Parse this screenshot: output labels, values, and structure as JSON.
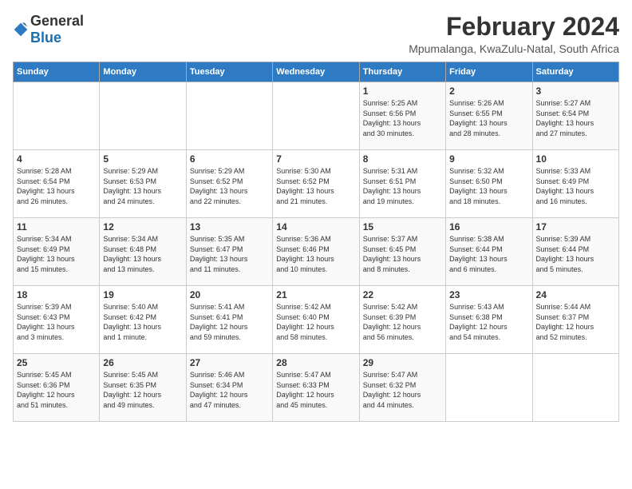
{
  "logo": {
    "general": "General",
    "blue": "Blue"
  },
  "title": "February 2024",
  "subtitle": "Mpumalanga, KwaZulu-Natal, South Africa",
  "weekdays": [
    "Sunday",
    "Monday",
    "Tuesday",
    "Wednesday",
    "Thursday",
    "Friday",
    "Saturday"
  ],
  "weeks": [
    [
      {
        "day": "",
        "info": ""
      },
      {
        "day": "",
        "info": ""
      },
      {
        "day": "",
        "info": ""
      },
      {
        "day": "",
        "info": ""
      },
      {
        "day": "1",
        "info": "Sunrise: 5:25 AM\nSunset: 6:56 PM\nDaylight: 13 hours\nand 30 minutes."
      },
      {
        "day": "2",
        "info": "Sunrise: 5:26 AM\nSunset: 6:55 PM\nDaylight: 13 hours\nand 28 minutes."
      },
      {
        "day": "3",
        "info": "Sunrise: 5:27 AM\nSunset: 6:54 PM\nDaylight: 13 hours\nand 27 minutes."
      }
    ],
    [
      {
        "day": "4",
        "info": "Sunrise: 5:28 AM\nSunset: 6:54 PM\nDaylight: 13 hours\nand 26 minutes."
      },
      {
        "day": "5",
        "info": "Sunrise: 5:29 AM\nSunset: 6:53 PM\nDaylight: 13 hours\nand 24 minutes."
      },
      {
        "day": "6",
        "info": "Sunrise: 5:29 AM\nSunset: 6:52 PM\nDaylight: 13 hours\nand 22 minutes."
      },
      {
        "day": "7",
        "info": "Sunrise: 5:30 AM\nSunset: 6:52 PM\nDaylight: 13 hours\nand 21 minutes."
      },
      {
        "day": "8",
        "info": "Sunrise: 5:31 AM\nSunset: 6:51 PM\nDaylight: 13 hours\nand 19 minutes."
      },
      {
        "day": "9",
        "info": "Sunrise: 5:32 AM\nSunset: 6:50 PM\nDaylight: 13 hours\nand 18 minutes."
      },
      {
        "day": "10",
        "info": "Sunrise: 5:33 AM\nSunset: 6:49 PM\nDaylight: 13 hours\nand 16 minutes."
      }
    ],
    [
      {
        "day": "11",
        "info": "Sunrise: 5:34 AM\nSunset: 6:49 PM\nDaylight: 13 hours\nand 15 minutes."
      },
      {
        "day": "12",
        "info": "Sunrise: 5:34 AM\nSunset: 6:48 PM\nDaylight: 13 hours\nand 13 minutes."
      },
      {
        "day": "13",
        "info": "Sunrise: 5:35 AM\nSunset: 6:47 PM\nDaylight: 13 hours\nand 11 minutes."
      },
      {
        "day": "14",
        "info": "Sunrise: 5:36 AM\nSunset: 6:46 PM\nDaylight: 13 hours\nand 10 minutes."
      },
      {
        "day": "15",
        "info": "Sunrise: 5:37 AM\nSunset: 6:45 PM\nDaylight: 13 hours\nand 8 minutes."
      },
      {
        "day": "16",
        "info": "Sunrise: 5:38 AM\nSunset: 6:44 PM\nDaylight: 13 hours\nand 6 minutes."
      },
      {
        "day": "17",
        "info": "Sunrise: 5:39 AM\nSunset: 6:44 PM\nDaylight: 13 hours\nand 5 minutes."
      }
    ],
    [
      {
        "day": "18",
        "info": "Sunrise: 5:39 AM\nSunset: 6:43 PM\nDaylight: 13 hours\nand 3 minutes."
      },
      {
        "day": "19",
        "info": "Sunrise: 5:40 AM\nSunset: 6:42 PM\nDaylight: 13 hours\nand 1 minute."
      },
      {
        "day": "20",
        "info": "Sunrise: 5:41 AM\nSunset: 6:41 PM\nDaylight: 12 hours\nand 59 minutes."
      },
      {
        "day": "21",
        "info": "Sunrise: 5:42 AM\nSunset: 6:40 PM\nDaylight: 12 hours\nand 58 minutes."
      },
      {
        "day": "22",
        "info": "Sunrise: 5:42 AM\nSunset: 6:39 PM\nDaylight: 12 hours\nand 56 minutes."
      },
      {
        "day": "23",
        "info": "Sunrise: 5:43 AM\nSunset: 6:38 PM\nDaylight: 12 hours\nand 54 minutes."
      },
      {
        "day": "24",
        "info": "Sunrise: 5:44 AM\nSunset: 6:37 PM\nDaylight: 12 hours\nand 52 minutes."
      }
    ],
    [
      {
        "day": "25",
        "info": "Sunrise: 5:45 AM\nSunset: 6:36 PM\nDaylight: 12 hours\nand 51 minutes."
      },
      {
        "day": "26",
        "info": "Sunrise: 5:45 AM\nSunset: 6:35 PM\nDaylight: 12 hours\nand 49 minutes."
      },
      {
        "day": "27",
        "info": "Sunrise: 5:46 AM\nSunset: 6:34 PM\nDaylight: 12 hours\nand 47 minutes."
      },
      {
        "day": "28",
        "info": "Sunrise: 5:47 AM\nSunset: 6:33 PM\nDaylight: 12 hours\nand 45 minutes."
      },
      {
        "day": "29",
        "info": "Sunrise: 5:47 AM\nSunset: 6:32 PM\nDaylight: 12 hours\nand 44 minutes."
      },
      {
        "day": "",
        "info": ""
      },
      {
        "day": "",
        "info": ""
      }
    ]
  ]
}
